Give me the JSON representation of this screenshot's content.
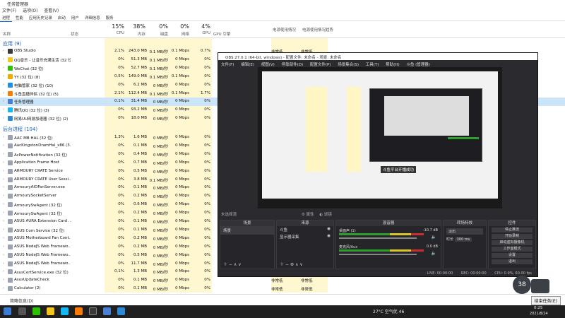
{
  "taskmgr": {
    "title": "任务管理器",
    "menu": [
      "文件(F)",
      "选项(O)",
      "查看(V)"
    ],
    "tabs": [
      "进程",
      "性能",
      "应用历史记录",
      "启动",
      "用户",
      "详细信息",
      "服务"
    ],
    "columns": {
      "name": "名称",
      "status": "状态",
      "cpu_pct": "15%",
      "cpu": "CPU",
      "mem_pct": "38%",
      "mem": "内存",
      "disk_pct": "0%",
      "disk": "磁盘",
      "net_pct": "0%",
      "net": "网络",
      "gpu_pct": "4%",
      "gpu": "GPU",
      "gpu_engine": "GPU 引擎",
      "power": "电源使用情况",
      "power_trend": "电源使用情况趋势"
    },
    "apps_header": "应用 (9)",
    "apps": [
      {
        "name": "OBS Studio",
        "cpu": "2.1%",
        "mem": "243.0 MB",
        "disk": "0.1 MB/秒",
        "net": "0.1 Mbps",
        "gpu": "0.7%",
        "color": "#3a3a3a"
      },
      {
        "name": "QQ音乐 - 让音乐充满生活 (32 位)",
        "cpu": "0%",
        "mem": "51.3 MB",
        "disk": "0.1 MB/秒",
        "net": "0 Mbps",
        "gpu": "0%",
        "color": "#f5c518"
      },
      {
        "name": "WeChat (32 位)",
        "cpu": "0%",
        "mem": "52.7 MB",
        "disk": "0.1 MB/秒",
        "net": "0 Mbps",
        "gpu": "0%",
        "color": "#2dc100"
      },
      {
        "name": "YY (32 位) (8)",
        "cpu": "0.5%",
        "mem": "149.0 MB",
        "disk": "0.1 MB/秒",
        "net": "0.1 Mbps",
        "gpu": "0%",
        "color": "#f2a900"
      },
      {
        "name": "电脑管家 (32 位) (10)",
        "cpu": "0%",
        "mem": "6.2 MB",
        "disk": "0 MB/秒",
        "net": "0 Mbps",
        "gpu": "0%",
        "color": "#1e8ee8"
      },
      {
        "name": "斗鱼直播伴侣 (32 位) (5)",
        "cpu": "2.1%",
        "mem": "112.4 MB",
        "disk": "0.1 MB/秒",
        "net": "0.1 Mbps",
        "gpu": "1.7%",
        "color": "#ff7a00"
      },
      {
        "name": "任务管理器",
        "cpu": "0.1%",
        "mem": "31.4 MB",
        "disk": "0 MB/秒",
        "net": "0 Mbps",
        "gpu": "0%",
        "color": "#4a7fd4"
      },
      {
        "name": "腾讯QQ (32 位) (3)",
        "cpu": "0%",
        "mem": "93.2 MB",
        "disk": "0 MB/秒",
        "net": "0 Mbps",
        "gpu": "0%",
        "color": "#12b7f5"
      },
      {
        "name": "网易UU网游加速器 (32 位) (2)",
        "cpu": "0%",
        "mem": "18.0 MB",
        "disk": "0 MB/秒",
        "net": "0 Mbps",
        "gpu": "0%",
        "color": "#2a8ad8"
      }
    ],
    "bg_header": "后台进程 (104)",
    "bg": [
      {
        "name": "AAC MB HAL (32 位)",
        "cpu": "1.3%",
        "mem": "1.6 MB",
        "disk": "0 MB/秒",
        "net": "0 Mbps",
        "gpu": "0%"
      },
      {
        "name": "AacKingstonDramHal_x86 (3...",
        "cpu": "0%",
        "mem": "0.1 MB",
        "disk": "0 MB/秒",
        "net": "0 Mbps",
        "gpu": "0%"
      },
      {
        "name": "AcPowerNotification (32 位)",
        "cpu": "0%",
        "mem": "0.4 MB",
        "disk": "0 MB/秒",
        "net": "0 Mbps",
        "gpu": "0%"
      },
      {
        "name": "Application Frame Host",
        "cpu": "0%",
        "mem": "0.7 MB",
        "disk": "0 MB/秒",
        "net": "0 Mbps",
        "gpu": "0%"
      },
      {
        "name": "ARMOURY CRATE Service",
        "cpu": "0%",
        "mem": "0.5 MB",
        "disk": "0 MB/秒",
        "net": "0 Mbps",
        "gpu": "0%"
      },
      {
        "name": "ARMOURY CRATE User Sessi...",
        "cpu": "0%",
        "mem": "3.8 MB",
        "disk": "0.1 MB/秒",
        "net": "0 Mbps",
        "gpu": "0%"
      },
      {
        "name": "ArmouryAIOFanServer.exe",
        "cpu": "0%",
        "mem": "0.1 MB",
        "disk": "0 MB/秒",
        "net": "0 Mbps",
        "gpu": "0%"
      },
      {
        "name": "ArmourySocketServer",
        "cpu": "0%",
        "mem": "0.2 MB",
        "disk": "0 MB/秒",
        "net": "0 Mbps",
        "gpu": "0%"
      },
      {
        "name": "ArmourySwAgent (32 位)",
        "cpu": "0%",
        "mem": "0.6 MB",
        "disk": "0 MB/秒",
        "net": "0 Mbps",
        "gpu": "0%"
      },
      {
        "name": "ArmourySwAgent (32 位)",
        "cpu": "0%",
        "mem": "0.2 MB",
        "disk": "0 MB/秒",
        "net": "0 Mbps",
        "gpu": "0%"
      },
      {
        "name": "ASUS AURA Extension Card ...",
        "cpu": "0%",
        "mem": "0.1 MB",
        "disk": "0 MB/秒",
        "net": "0 Mbps",
        "gpu": "0%"
      },
      {
        "name": "ASUS Com Service (32 位)",
        "cpu": "0%",
        "mem": "0.1 MB",
        "disk": "0 MB/秒",
        "net": "0 Mbps",
        "gpu": "0%"
      },
      {
        "name": "ASUS Motherboard Fan Cont...",
        "cpu": "0%",
        "mem": "0.2 MB",
        "disk": "0 MB/秒",
        "net": "0 Mbps",
        "gpu": "0%"
      },
      {
        "name": "ASUS NodeJS Web Framewo...",
        "cpu": "0%",
        "mem": "0.2 MB",
        "disk": "0 MB/秒",
        "net": "0 Mbps",
        "gpu": "0%"
      },
      {
        "name": "ASUS NodeJS Web Framewo...",
        "cpu": "0%",
        "mem": "0.5 MB",
        "disk": "0 MB/秒",
        "net": "0 Mbps",
        "gpu": "0%"
      },
      {
        "name": "ASUS NodeJS Web Framewo...",
        "cpu": "0%",
        "mem": "11.7 MB",
        "disk": "0 MB/秒",
        "net": "0 Mbps",
        "gpu": "0%"
      },
      {
        "name": "AsusCertService.exe (32 位)",
        "cpu": "0.1%",
        "mem": "1.3 MB",
        "disk": "0 MB/秒",
        "net": "0 Mbps",
        "gpu": "0%"
      },
      {
        "name": "AsusUpdateCheck",
        "cpu": "0%",
        "mem": "0.1 MB",
        "disk": "0 MB/秒",
        "net": "0 Mbps",
        "gpu": "0%"
      },
      {
        "name": "Calculator (2)",
        "cpu": "0%",
        "mem": "0.1 MB",
        "disk": "0 MB/秒",
        "net": "0 Mbps",
        "gpu": "0%"
      }
    ],
    "power_low": "非常低",
    "footer_left": "简略信息(D)",
    "footer_btn": "结束任务(E)"
  },
  "obs": {
    "title": "OBS 27.0.1 (64-bit, windows) - 配置文件: 未命名 - 场景: 未命名",
    "menu": [
      "文件(F)",
      "编辑(E)",
      "视图(V)",
      "停靠部件(D)",
      "配置文件(P)",
      "场景集合(S)",
      "工具(T)",
      "帮助(H)",
      "斗鱼 (管理器)"
    ],
    "preview_toast": "斗鱼平台开播成功",
    "no_source": "未选择源",
    "props_label": "属性",
    "filters_label": "滤镜",
    "docks": {
      "scenes": "场景",
      "sources": "来源",
      "mixer": "混音器",
      "transitions": "转场特效",
      "controls": "控件"
    },
    "scene_item": "场景",
    "source_items": [
      "斗鱼",
      "显示器采集"
    ],
    "mixer_tracks": [
      {
        "name": "桌面声 (1)",
        "db": "-10.7 dB"
      },
      {
        "name": "麦克风/Aux",
        "db": "0.0 dB"
      }
    ],
    "transition_select": "淡出",
    "duration_label": "时长",
    "duration_value": "300 ms",
    "control_buttons": [
      "停止推流",
      "开始录制",
      "启动虚拟摄像机",
      "工作室模式",
      "设置",
      "退出"
    ],
    "status_live": "LIVE: 00:00:00",
    "status_rec": "REC: 00:00:00",
    "status_cpu": "CPU: 0.9%, 60.00 fps"
  },
  "badge": "38",
  "taskbar": {
    "weather": "27°C 空气优 46",
    "time": "0:25",
    "date": "2021/8/24"
  },
  "colors": {
    "accent": "#1a5fb4",
    "shade": "#fff7cf",
    "obs_bg": "#2b2b2f",
    "taskbar": "#202020"
  }
}
